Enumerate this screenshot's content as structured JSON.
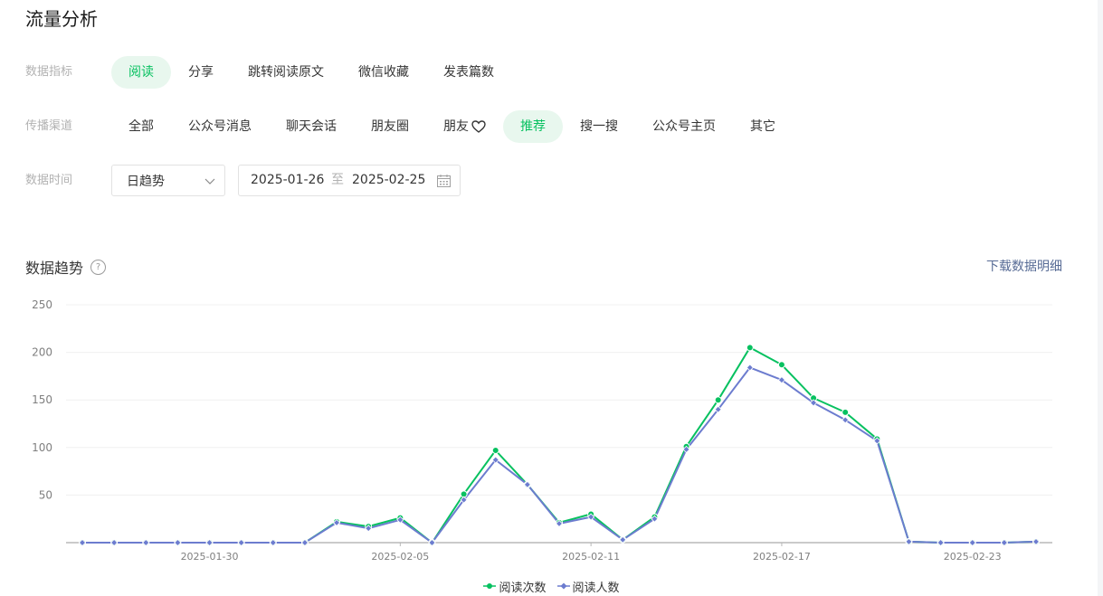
{
  "page": {
    "title": "流量分析"
  },
  "filters": {
    "metric": {
      "label": "数据指标",
      "options": [
        "阅读",
        "分享",
        "跳转阅读原文",
        "微信收藏",
        "发表篇数"
      ],
      "active": 0
    },
    "channel": {
      "label": "传播渠道",
      "options": [
        "全部",
        "公众号消息",
        "聊天会话",
        "朋友圈",
        "朋友",
        "推荐",
        "搜一搜",
        "公众号主页",
        "其它"
      ],
      "active": 5,
      "heart_option": 4
    },
    "time": {
      "label": "数据时间",
      "granularity": "日趋势",
      "start_date": "2025-01-26",
      "separator": "至",
      "end_date": "2025-02-25"
    }
  },
  "trend": {
    "title": "数据趋势",
    "help": "?",
    "download_label": "下载数据明细"
  },
  "chart_data": {
    "type": "line",
    "x": [
      "2025-01-26",
      "2025-01-27",
      "2025-01-28",
      "2025-01-29",
      "2025-01-30",
      "2025-01-31",
      "2025-02-01",
      "2025-02-02",
      "2025-02-03",
      "2025-02-04",
      "2025-02-05",
      "2025-02-06",
      "2025-02-07",
      "2025-02-08",
      "2025-02-09",
      "2025-02-10",
      "2025-02-11",
      "2025-02-12",
      "2025-02-13",
      "2025-02-14",
      "2025-02-15",
      "2025-02-16",
      "2025-02-17",
      "2025-02-18",
      "2025-02-19",
      "2025-02-20",
      "2025-02-21",
      "2025-02-22",
      "2025-02-23",
      "2025-02-24",
      "2025-02-25"
    ],
    "x_ticks": [
      "2025-01-30",
      "2025-02-05",
      "2025-02-11",
      "2025-02-17",
      "2025-02-23"
    ],
    "y_ticks": [
      50,
      100,
      150,
      200,
      250
    ],
    "ylim": [
      0,
      250
    ],
    "grid": true,
    "legend_position": "bottom",
    "series": [
      {
        "name": "阅读次数",
        "color": "#07c160",
        "marker": "circle",
        "values": [
          0,
          0,
          0,
          0,
          0,
          0,
          0,
          0,
          22,
          17,
          26,
          0,
          51,
          97,
          61,
          21,
          30,
          3,
          27,
          101,
          150,
          205,
          187,
          152,
          137,
          109,
          1,
          0,
          0,
          0,
          1
        ]
      },
      {
        "name": "阅读人数",
        "color": "#6c7ccf",
        "marker": "diamond",
        "values": [
          0,
          0,
          0,
          0,
          0,
          0,
          0,
          0,
          21,
          15,
          24,
          0,
          45,
          87,
          61,
          20,
          27,
          3,
          25,
          98,
          140,
          184,
          171,
          147,
          129,
          107,
          1,
          0,
          0,
          0,
          1
        ]
      }
    ]
  }
}
